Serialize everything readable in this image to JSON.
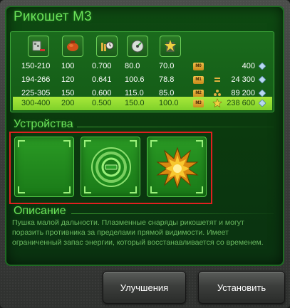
{
  "title": "Рикошет М3",
  "stat_icons": [
    "armor-plate-icon",
    "fuel-canister-icon",
    "ammo-clock-icon",
    "radar-gauge-icon",
    "energy-burst-icon"
  ],
  "rows": [
    {
      "range": "150-210",
      "val1": "100",
      "val2": "0.700",
      "val3": "80.0",
      "val4": "70.0",
      "badge": "M0",
      "price": "400",
      "rank_icon": "none"
    },
    {
      "range": "194-266",
      "val1": "120",
      "val2": "0.641",
      "val3": "100.6",
      "val4": "78.8",
      "badge": "M1",
      "price": "24 300",
      "rank_icon": "chevron-rank-icon"
    },
    {
      "range": "225-305",
      "val1": "150",
      "val2": "0.600",
      "val3": "115.0",
      "val4": "85.0",
      "badge": "M2",
      "price": "89 200",
      "rank_icon": "triple-star-rank-icon"
    },
    {
      "range": "300-400",
      "val1": "200",
      "val2": "0.500",
      "val3": "150.0",
      "val4": "100.0",
      "badge": "M3",
      "price": "238 600",
      "rank_icon": "star-rank-icon"
    }
  ],
  "devices_heading": "Устройства",
  "description_heading": "Описание",
  "description": "Пушка малой дальности. Плазменные снаряды рикошетят и могут поразить противника за пределами прямой видимости. Имеет ограниченный запас энергии, который восстанавливается со временем.",
  "buttons": {
    "upgrades": "Улучшения",
    "install": "Установить"
  },
  "colors": {
    "accent_green": "#6be35a",
    "active_row": "#a8e83a",
    "highlight_border": "#e02020",
    "crystal": "#b8d8f0"
  }
}
